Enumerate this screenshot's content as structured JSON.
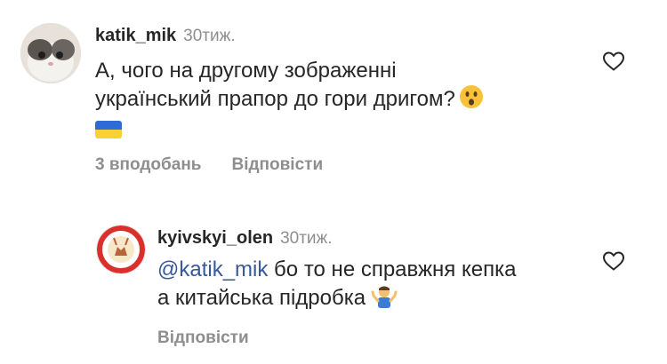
{
  "comments": [
    {
      "username": "katik_mik",
      "time": "30тиж.",
      "lines": [
        "А, чого на другому зображенні",
        "український прапор до гори дригом?"
      ],
      "reaction_emoji": "hushed-face",
      "flag": "ukrainian-flag",
      "likes": "3 вподобань",
      "reply_label": "Відповісти"
    },
    {
      "username": "kyivskyi_olen",
      "time": "30тиж.",
      "mention": "@katik_mik",
      "line1_rest": " бо то не справжня кепка",
      "line2": "а китайська підробка",
      "reaction_emoji": "man-shrugging",
      "reply_label": "Відповісти"
    }
  ],
  "icons": {
    "like": "heart-icon"
  },
  "colors": {
    "text": "#262626",
    "muted": "#8e8e8e",
    "mention": "#385898",
    "flag_blue": "#2f6bd6",
    "flag_yellow": "#f7d232"
  }
}
